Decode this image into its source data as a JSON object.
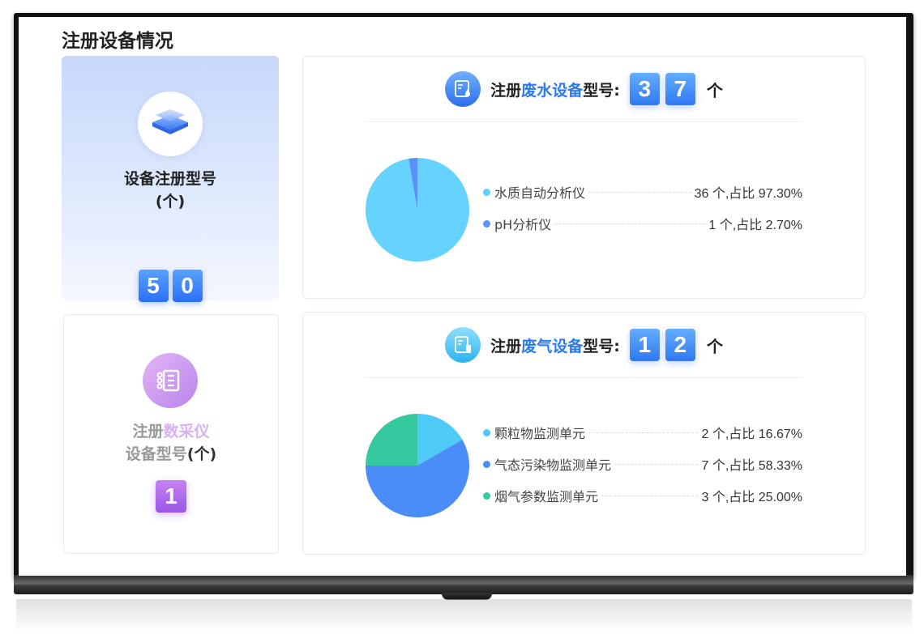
{
  "page": {
    "title": "注册设备情况"
  },
  "total_card": {
    "label_line1": "设备注册型号",
    "label_line2": "(个)",
    "digits": [
      "5",
      "0"
    ]
  },
  "collector_card": {
    "label_prefix": "注册",
    "label_highlight": "数采仪",
    "label_line2": "设备型号",
    "label_unit": "(个)",
    "digits": [
      "1"
    ]
  },
  "wastewater": {
    "title_prefix": "注册",
    "title_highlight": "废水设备",
    "title_suffix": "型号:",
    "digits": [
      "3",
      "7"
    ],
    "unit": "个",
    "legend": [
      {
        "name": "水质自动分析仪",
        "value": "36 个,占比 97.30%",
        "color": "#5ecfff"
      },
      {
        "name": "pH分析仪",
        "value": "1 个,占比 2.70%",
        "color": "#5b8ff9"
      }
    ]
  },
  "wastegas": {
    "title_prefix": "注册",
    "title_highlight": "废气设备",
    "title_suffix": "型号:",
    "digits": [
      "1",
      "2"
    ],
    "unit": "个",
    "legend": [
      {
        "name": "颗粒物监测单元",
        "value": "2 个,占比 16.67%",
        "color": "#4fc9f5"
      },
      {
        "name": "气态污染物监测单元",
        "value": "7 个,占比 58.33%",
        "color": "#4b8df8"
      },
      {
        "name": "烟气参数监测单元",
        "value": "3 个,占比 25.00%",
        "color": "#36c9a0"
      }
    ]
  },
  "chart_data": [
    {
      "type": "pie",
      "title": "",
      "categories": [
        "水质自动分析仪",
        "pH分析仪"
      ],
      "values": [
        36,
        1
      ],
      "colors": [
        "#66d2ff",
        "#5b8ff9"
      ]
    },
    {
      "type": "pie",
      "title": "",
      "categories": [
        "颗粒物监测单元",
        "气态污染物监测单元",
        "烟气参数监测单元"
      ],
      "values": [
        2,
        7,
        3
      ],
      "colors": [
        "#4fc9f5",
        "#4b8df8",
        "#36c9a0"
      ]
    }
  ]
}
